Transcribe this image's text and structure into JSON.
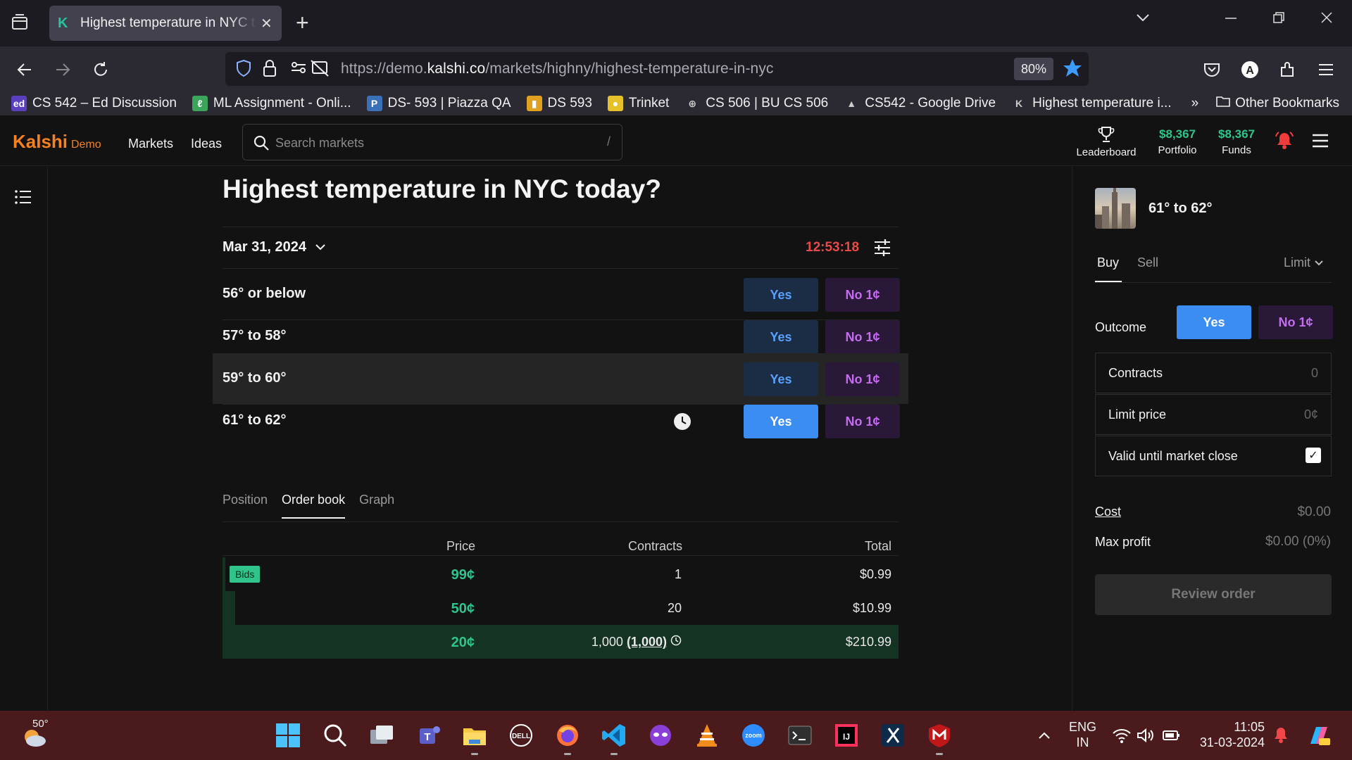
{
  "browser": {
    "tab_title": "Highest temperature in NYC today?",
    "tab_favicon": "K",
    "url_prefix": "https://demo.",
    "url_domain": "kalshi.co",
    "url_path": "/markets/highny/highest-temperature-in-nyc",
    "zoom": "80%",
    "bookmarks": [
      {
        "icon": "ed",
        "color": "#5a3fbf",
        "label": "CS 542 – Ed Discussion"
      },
      {
        "icon": "ℓ",
        "color": "#3aa55b",
        "label": "ML Assignment - Onli..."
      },
      {
        "icon": "P",
        "color": "#3b6fb6",
        "label": "DS- 593 | Piazza QA"
      },
      {
        "icon": "▮",
        "color": "#e0a020",
        "label": "DS 593"
      },
      {
        "icon": "●",
        "color": "#e6c12a",
        "label": "Trinket"
      },
      {
        "icon": "⊕",
        "color": "transparent",
        "label": "CS 506 | BU CS 506"
      },
      {
        "icon": "▲",
        "color": "transparent",
        "label": "CS542 - Google Drive"
      },
      {
        "icon": "K",
        "color": "transparent",
        "label": "Highest temperature i..."
      }
    ],
    "other_bookmarks": "Other Bookmarks"
  },
  "app": {
    "logo": "Kalshi",
    "logo_tag": "Demo",
    "nav": [
      "Markets",
      "Ideas"
    ],
    "search_placeholder": "Search markets",
    "search_shortcut": "/",
    "leaderboard": "Leaderboard",
    "portfolio_value": "$8,367",
    "portfolio_label": "Portfolio",
    "funds_value": "$8,367",
    "funds_label": "Funds"
  },
  "market": {
    "title": "Highest temperature in NYC today?",
    "date": "Mar 31, 2024",
    "timer": "12:53:18",
    "outcomes": [
      {
        "label": "56° or below",
        "yes": "Yes",
        "no": "No 1¢"
      },
      {
        "label": "57° to 58°",
        "yes": "Yes",
        "no": "No 1¢"
      },
      {
        "label": "59° to 60°",
        "yes": "Yes",
        "no": "No 1¢"
      },
      {
        "label": "61° to 62°",
        "yes": "Yes",
        "no": "No 1¢"
      }
    ],
    "tabs": [
      "Position",
      "Order book",
      "Graph"
    ],
    "orderbook": {
      "headers": {
        "price": "Price",
        "contracts": "Contracts",
        "total": "Total"
      },
      "bids_label": "Bids",
      "rows": [
        {
          "price": "99¢",
          "contracts": "1",
          "extra": "",
          "total": "$0.99"
        },
        {
          "price": "50¢",
          "contracts": "20",
          "extra": "",
          "total": "$10.99"
        },
        {
          "price": "20¢",
          "contracts": "1,000",
          "extra": "(1,000)",
          "total": "$210.99"
        }
      ]
    }
  },
  "order": {
    "selected": "61° to 62°",
    "buy": "Buy",
    "sell": "Sell",
    "order_type": "Limit",
    "outcome_label": "Outcome",
    "yes": "Yes",
    "no": "No 1¢",
    "contracts_label": "Contracts",
    "contracts_value": "0",
    "limit_label": "Limit price",
    "limit_value": "0¢",
    "valid_label": "Valid until market close",
    "valid_checked": true,
    "cost_label": "Cost",
    "cost_value": "$0.00",
    "maxprofit_label": "Max profit",
    "maxprofit_value": "$0.00 (0%)",
    "review": "Review order"
  },
  "taskbar": {
    "weather_temp": "50°",
    "lang_top": "ENG",
    "lang_bottom": "IN",
    "time": "11:05",
    "date": "31-03-2024"
  }
}
